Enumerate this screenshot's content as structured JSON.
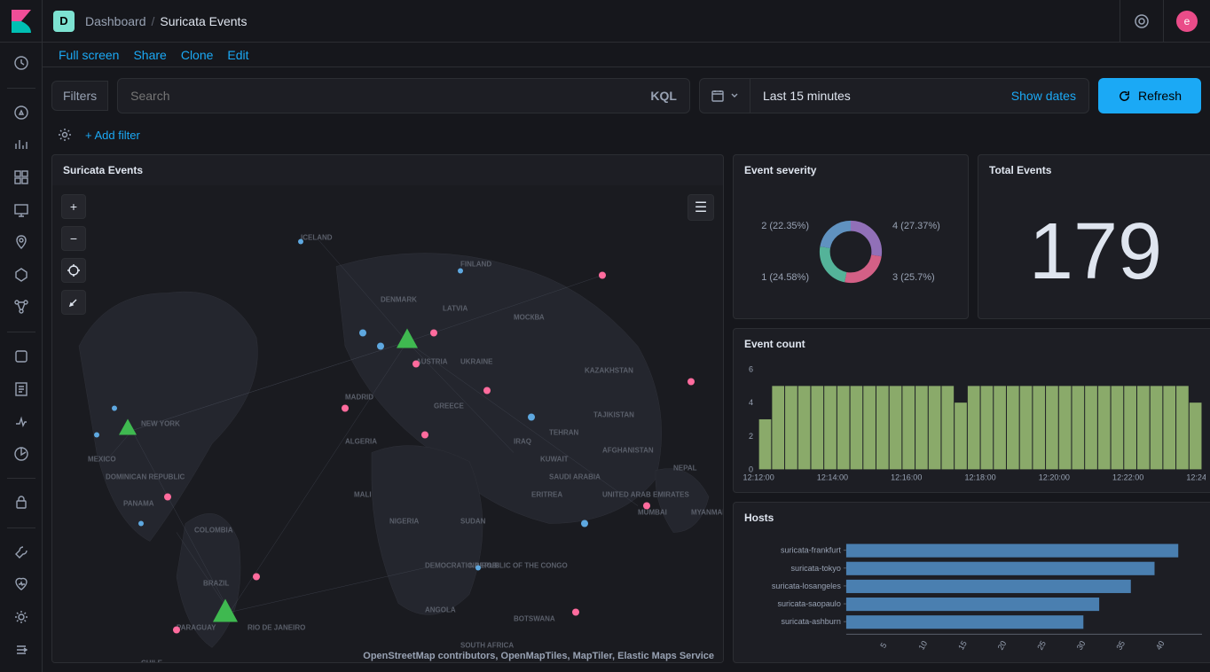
{
  "header": {
    "space_letter": "D",
    "breadcrumb_root": "Dashboard",
    "breadcrumb_current": "Suricata Events",
    "avatar_letter": "e"
  },
  "toolbar": {
    "full_screen": "Full screen",
    "share": "Share",
    "clone": "Clone",
    "edit": "Edit"
  },
  "filterbar": {
    "filters_label": "Filters",
    "search_placeholder": "Search",
    "kql_label": "KQL",
    "date_range": "Last 15 minutes",
    "show_dates": "Show dates",
    "refresh": "Refresh",
    "add_filter": "+ Add filter"
  },
  "panels": {
    "map_title": "Suricata Events",
    "map_attribution": "OpenStreetMap contributors, OpenMapTiles, MapTiler, Elastic Maps Service",
    "severity_title": "Event severity",
    "total_title": "Total Events",
    "total_value": "179",
    "count_title": "Event count",
    "hosts_title": "Hosts"
  },
  "chart_data": [
    {
      "type": "pie",
      "title": "Event severity",
      "series": [
        {
          "name": "1",
          "value": 24.58,
          "label": "1 (24.58%)",
          "color": "#54b399"
        },
        {
          "name": "2",
          "value": 22.35,
          "label": "2 (22.35%)",
          "color": "#6092c0"
        },
        {
          "name": "3",
          "value": 25.7,
          "label": "3 (25.7%)",
          "color": "#d36086"
        },
        {
          "name": "4",
          "value": 27.37,
          "label": "4 (27.37%)",
          "color": "#9170b8"
        }
      ]
    },
    {
      "type": "bar",
      "title": "Event count",
      "x": [
        "12:12:00",
        "12:14:00",
        "12:16:00",
        "12:18:00",
        "12:20:00",
        "12:22:00",
        "12:24:00"
      ],
      "ylim": [
        0,
        6
      ],
      "yticks": [
        0,
        2,
        4,
        6
      ],
      "values": [
        3,
        5,
        5,
        5,
        5,
        5,
        5,
        5,
        5,
        5,
        5,
        5,
        5,
        5,
        5,
        4,
        5,
        5,
        5,
        5,
        5,
        5,
        5,
        5,
        5,
        5,
        5,
        5,
        5,
        5,
        5,
        5,
        5,
        4
      ]
    },
    {
      "type": "bar",
      "orientation": "horizontal",
      "title": "Hosts",
      "categories": [
        "suricata-frankfurt",
        "suricata-tokyo",
        "suricata-losangeles",
        "suricata-saopaulo",
        "suricata-ashburn"
      ],
      "values": [
        42,
        39,
        36,
        32,
        30
      ],
      "xlim": [
        0,
        45
      ],
      "xticks": [
        5,
        10,
        15,
        20,
        25,
        30,
        35,
        40
      ]
    }
  ]
}
